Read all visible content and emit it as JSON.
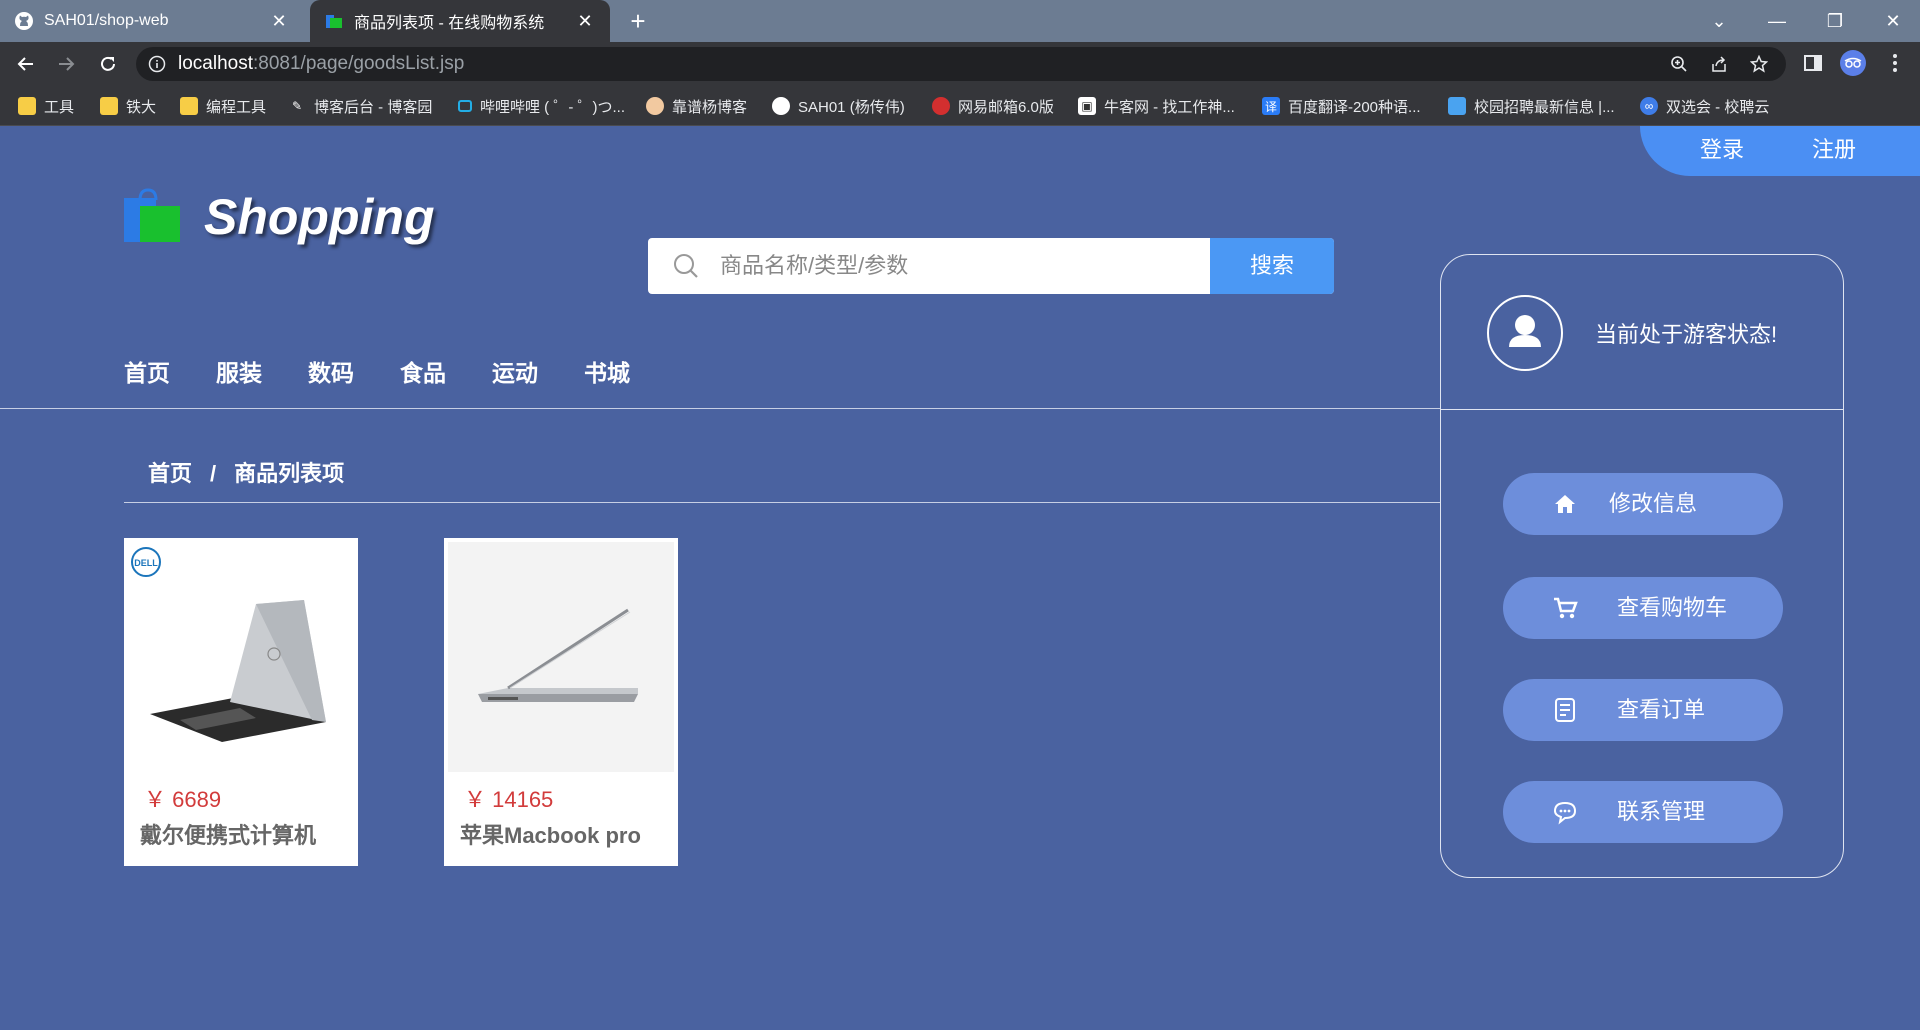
{
  "browser": {
    "tabs": [
      {
        "title": "SAH01/shop-web",
        "icon": "github-icon"
      },
      {
        "title": "商品列表项 - 在线购物系统",
        "icon": "folder-icon"
      }
    ],
    "url_host": "localhost",
    "url_rest": ":8081/page/goodsList.jsp"
  },
  "bookmarks": [
    {
      "label": "工具",
      "icon": "folder-icon",
      "color": "#f7cd46"
    },
    {
      "label": "铁大",
      "icon": "folder-icon",
      "color": "#f7cd46"
    },
    {
      "label": "编程工具",
      "icon": "folder-icon",
      "color": "#f7cd46"
    },
    {
      "label": "博客后台 - 博客园",
      "icon": "cnblogs-icon",
      "color": "#ffffff"
    },
    {
      "label": "哔哩哔哩 ( ゜- ゜)つ...",
      "icon": "bilibili-icon",
      "color": "#23ade5"
    },
    {
      "label": "靠谱杨博客",
      "icon": "blog-icon",
      "color": "#f2c9a0"
    },
    {
      "label": "SAH01 (杨传伟)",
      "icon": "github-icon",
      "color": "#ffffff"
    },
    {
      "label": "网易邮箱6.0版",
      "icon": "mail-icon",
      "color": "#d32f2f"
    },
    {
      "label": "牛客网 - 找工作神...",
      "icon": "nowcoder-icon",
      "color": "#ffffff"
    },
    {
      "label": "百度翻译-200种语...",
      "icon": "translate-icon",
      "color": "#2a7cf7"
    },
    {
      "label": "校园招聘最新信息 |...",
      "icon": "campus-icon",
      "color": "#4aa3f0"
    },
    {
      "label": "双选会 - 校聘云",
      "icon": "xiaopin-icon",
      "color": "#3f7de8"
    }
  ],
  "auth": {
    "login": "登录",
    "register": "注册"
  },
  "brand": "Shopping",
  "search": {
    "placeholder": "商品名称/类型/参数",
    "button": "搜索"
  },
  "nav": [
    "首页",
    "服装",
    "数码",
    "食品",
    "运动",
    "书城"
  ],
  "breadcrumb": {
    "home": "首页",
    "separator": "/",
    "current": "商品列表项"
  },
  "products": [
    {
      "price": "￥ 6689",
      "name": "戴尔便携式计算机"
    },
    {
      "price": "￥ 14165",
      "name": "苹果Macbook pro"
    }
  ],
  "panel": {
    "status": "当前处于游客状态!",
    "buttons": [
      {
        "label": "修改信息",
        "icon": "home-icon"
      },
      {
        "label": "查看购物车",
        "icon": "cart-icon"
      },
      {
        "label": "查看订单",
        "icon": "order-icon"
      },
      {
        "label": "联系管理",
        "icon": "chat-icon"
      }
    ]
  },
  "colors": {
    "page_bg": "#4a62a0",
    "accent": "#4b98f4",
    "price": "#d23b3b",
    "panel_button": "#6d8edb"
  }
}
